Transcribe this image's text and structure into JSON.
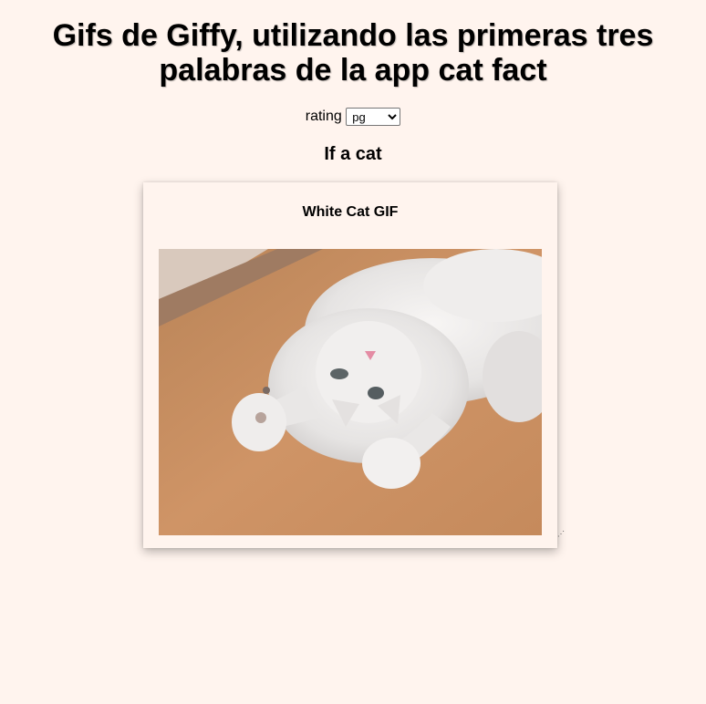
{
  "header": {
    "title": "Gifs de Giffy, utilizando las primeras tres palabras de la app cat fact"
  },
  "rating": {
    "label": "rating",
    "selected": "pg"
  },
  "fact": {
    "first_words": "If a cat"
  },
  "gif_card": {
    "title": "White Cat GIF",
    "image_alt": "White Cat GIF"
  },
  "colors": {
    "background": "#fff4ee",
    "floor": "#c98c5e",
    "cat": "#eeeeee"
  }
}
